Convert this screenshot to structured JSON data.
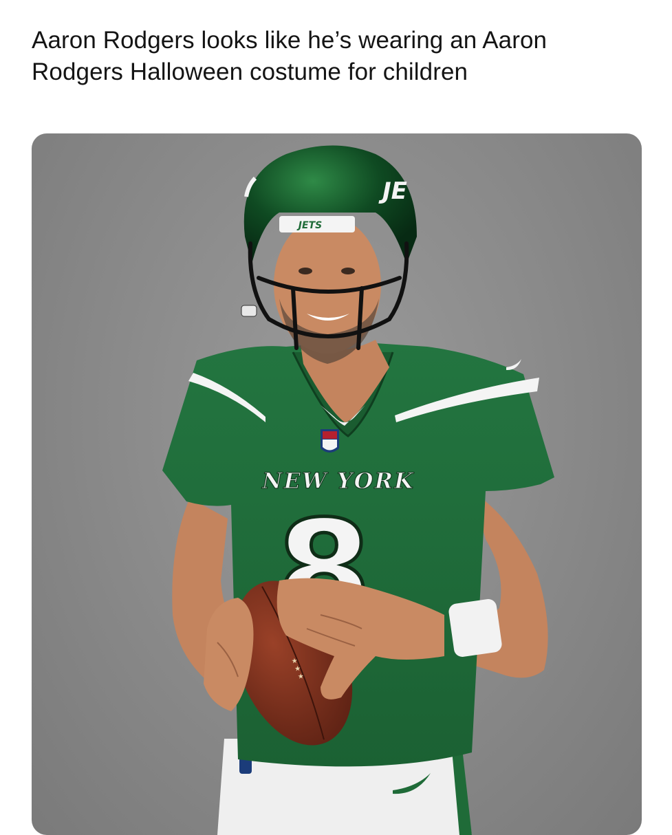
{
  "post": {
    "caption_line1": "Aaron Rodgers looks like he’s wearing an Aaron",
    "caption_line2": "Rodgers Halloween costume for children"
  },
  "photo": {
    "helmet_text": "JE",
    "helmet_bumper_text": "JETS",
    "jersey_text": "NEW YORK",
    "jersey_number": "8",
    "colors": {
      "background": "#8c8c8c",
      "jersey_green": "#1f6b38",
      "helmet_green": "#0f4a22",
      "white": "#f4f4f4",
      "skin": "#c98a63",
      "ball": "#7a2e1c"
    }
  }
}
